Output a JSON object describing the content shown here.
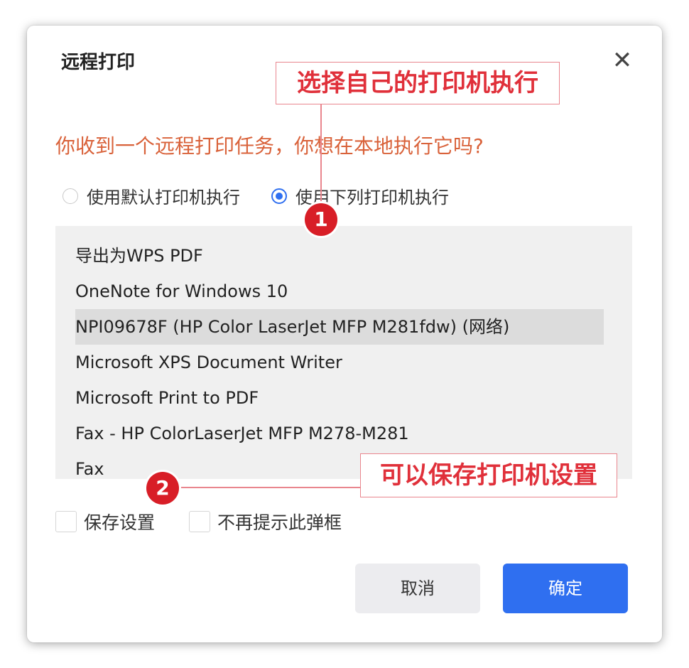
{
  "dialog": {
    "title": "远程打印",
    "close_label": "✕",
    "prompt": "你收到一个远程打印任务，你想在本地执行它吗?",
    "radio_default": "使用默认打印机执行",
    "radio_list": "使用下列打印机执行",
    "printers": [
      "导出为WPS PDF",
      "OneNote for Windows 10",
      "NPI09678F (HP Color LaserJet MFP M281fdw) (网络)",
      "Microsoft XPS Document Writer",
      "Microsoft Print to PDF",
      "Fax - HP ColorLaserJet MFP M278-M281",
      "Fax"
    ],
    "selected_printer": "NPI09678F (HP Color LaserJet MFP M281fdw) (网络)",
    "save_settings": "保存设置",
    "no_prompt": "不再提示此弹框",
    "cancel": "取消",
    "ok": "确定"
  },
  "annotations": {
    "callout1": "选择自己的打印机执行",
    "callout2": "可以保存打印机设置",
    "badge1": "1",
    "badge2": "2"
  },
  "colors": {
    "accent": "#2f6ff0",
    "prompt": "#d9623a",
    "annotation": "#d81e27"
  }
}
